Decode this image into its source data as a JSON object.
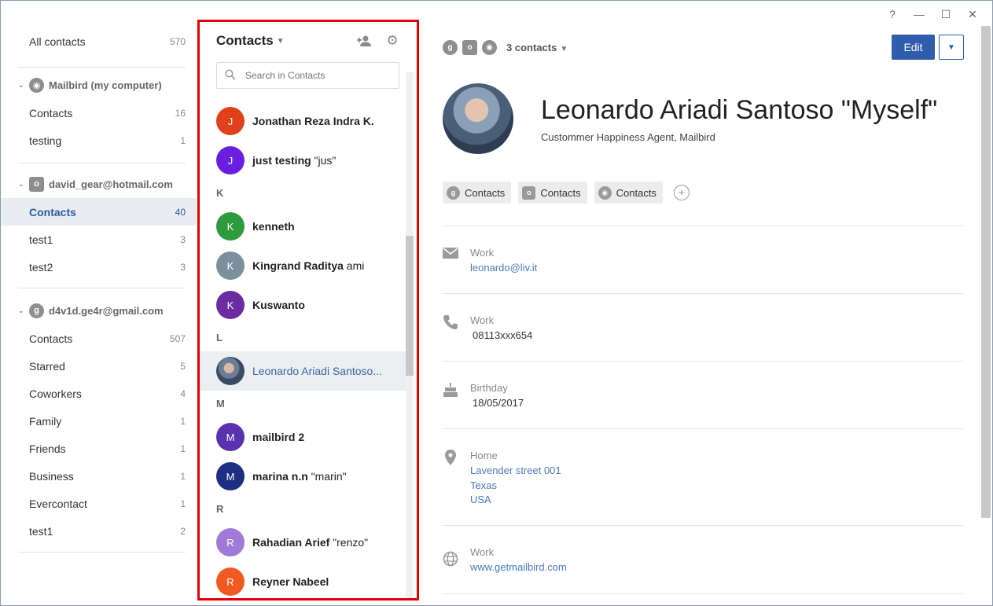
{
  "window_controls": {
    "help": "?",
    "minimize": "—",
    "maximize": "☐",
    "close": "✕"
  },
  "sidebar": {
    "all_contacts": {
      "label": "All contacts",
      "count": "570"
    },
    "accounts": [
      {
        "name": "Mailbird (my computer)",
        "items": [
          {
            "label": "Contacts",
            "count": "16"
          },
          {
            "label": "testing",
            "count": "1"
          }
        ]
      },
      {
        "name": "david_gear@hotmail.com",
        "items": [
          {
            "label": "Contacts",
            "count": "40"
          },
          {
            "label": "test1",
            "count": "3"
          },
          {
            "label": "test2",
            "count": "3"
          }
        ]
      },
      {
        "name": "d4v1d.ge4r@gmail.com",
        "items": [
          {
            "label": "Contacts",
            "count": "507"
          },
          {
            "label": "Starred",
            "count": "5"
          },
          {
            "label": "Coworkers",
            "count": "4"
          },
          {
            "label": "Family",
            "count": "1"
          },
          {
            "label": "Friends",
            "count": "1"
          },
          {
            "label": "Business",
            "count": "1"
          },
          {
            "label": "Evercontact",
            "count": "1"
          },
          {
            "label": "test1",
            "count": "2"
          }
        ]
      }
    ]
  },
  "list": {
    "title": "Contacts",
    "search_placeholder": "Search in Contacts",
    "sections": [
      "K",
      "L",
      "M",
      "R"
    ],
    "contacts": [
      {
        "initial": "J",
        "name": "Jonathan Reza Indra K.",
        "nick": "",
        "color": "#e0401c"
      },
      {
        "initial": "J",
        "name": "just testing",
        "nick": " \"jus\"",
        "color": "#6a1fe0"
      },
      {
        "initial": "K",
        "name": "kenneth",
        "nick": "",
        "color": "#2e9a3e"
      },
      {
        "initial": "K",
        "name": "Kingrand Raditya",
        "nick": " ami",
        "color": "#7b8f9c"
      },
      {
        "initial": "K",
        "name": "Kuswanto",
        "nick": "",
        "color": "#6a2ca0"
      },
      {
        "initial": "",
        "name": "Leonardo Ariadi Santoso...",
        "nick": "",
        "color": "#5a6a80"
      },
      {
        "initial": "M",
        "name": "mailbird 2",
        "nick": "",
        "color": "#5a32b0"
      },
      {
        "initial": "M",
        "name": "marina n.n",
        "nick": " \"marin\"",
        "color": "#1c2f80"
      },
      {
        "initial": "R",
        "name": "Rahadian Arief",
        "nick": " \"renzo\"",
        "color": "#a07ad8"
      },
      {
        "initial": "R",
        "name": "Reyner Nabeel",
        "nick": "",
        "color": "#f05a22"
      }
    ]
  },
  "details": {
    "source_count": "3 contacts",
    "edit_label": "Edit",
    "full_name": "Leonardo Ariadi Santoso \"Myself\"",
    "subtitle": "Custommer Happiness Agent, Mailbird",
    "chips": [
      "Contacts",
      "Contacts",
      "Contacts"
    ],
    "fields": {
      "email": {
        "label": "Work",
        "value": "leonardo@liv.it"
      },
      "phone": {
        "label": "Work",
        "value": "08113xxx654"
      },
      "birthday": {
        "label": "Birthday",
        "value": "18/05/2017"
      },
      "address": {
        "label": "Home",
        "line1": "Lavender street 001",
        "line2": "Texas",
        "line3": "USA"
      },
      "website": {
        "label": "Work",
        "value": "www.getmailbird.com"
      }
    }
  },
  "icons": {
    "add_contact": "person-add-icon",
    "settings": "gear-icon",
    "search": "search-icon",
    "email": "envelope-icon",
    "phone": "phone-icon",
    "birthday": "cake-icon",
    "address": "location-pin-icon",
    "website": "globe-icon"
  }
}
